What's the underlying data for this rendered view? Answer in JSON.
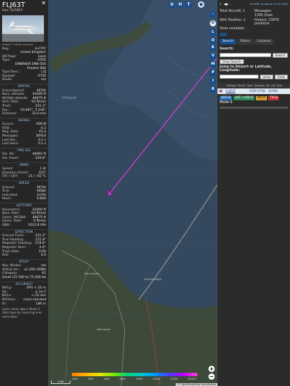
{
  "aircraft": {
    "callsign": "FLJ63T",
    "hex_line": "Hex: 407BF5",
    "photo_credit": "Image © Mario Santoro",
    "fields_top": [
      {
        "k": "Reg.:",
        "v": "G-FTFY"
      },
      {
        "k": "",
        "v": "United Kingdom"
      },
      {
        "k": "DB flags:",
        "v": "none"
      },
      {
        "k": "Type:",
        "v": "E550"
      },
      {
        "k": "",
        "v": "EMBRAER EMB-550"
      },
      {
        "k": "",
        "v": "Praetor 600"
      },
      {
        "k": "Type Desc.:",
        "v": "L2J"
      },
      {
        "k": "Squawk:",
        "v": "0756"
      },
      {
        "k": "Route:",
        "v": "n/a"
      }
    ],
    "spatial": [
      {
        "k": "Groundspeed:",
        "v": "467kt"
      },
      {
        "k": "Baro. altitude:",
        "v": "41000 ft"
      },
      {
        "k": "WGS84 altitude:",
        "v": "40675 ft"
      },
      {
        "k": "Vert. Rate:",
        "v": "64 ft/min"
      },
      {
        "k": "Track:",
        "v": "221.3°"
      },
      {
        "k": "Pos.:",
        "v": "53.067°, 5.030°"
      },
      {
        "k": "Distance:",
        "v": "33.0 nmi"
      }
    ],
    "signal": [
      {
        "k": "Source:",
        "v": "ADS-B"
      },
      {
        "k": "RSSI:",
        "v": "-4.2"
      },
      {
        "k": "Msg. Rate:",
        "v": "45.4"
      },
      {
        "k": "Messages:",
        "v": "30910"
      },
      {
        "k": "Last Pos.:",
        "v": "0.1 s"
      },
      {
        "k": "Last Seen:",
        "v": "0.1 s"
      }
    ],
    "fms": [
      {
        "k": "Sel. Alt.:",
        "v": "40992 ft"
      },
      {
        "k": "Sel. Head.:",
        "v": "220.8°"
      }
    ],
    "wind": [
      {
        "k": "Speed:",
        "v": "1 kt"
      },
      {
        "k": "Direction (from):",
        "v": "323°"
      },
      {
        "k": "TAT / OAT:",
        "v": "-21 / -50 °C"
      }
    ],
    "speed": [
      {
        "k": "Ground:",
        "v": "467kt"
      },
      {
        "k": "True:",
        "v": "468kt"
      },
      {
        "k": "Indicated:",
        "v": "237kt"
      },
      {
        "k": "Mach:",
        "v": "0.800"
      }
    ],
    "altitude": [
      {
        "k": "Barometric:",
        "v": "41000 ft"
      },
      {
        "k": "Baro. Rate:",
        "v": "64 ft/min"
      },
      {
        "k": "Geom. WGS84:",
        "v": "40675 ft"
      },
      {
        "k": "Geom. Rate:",
        "v": "0 ft/min"
      },
      {
        "k": "QNH:",
        "v": "1012.8 hPa"
      }
    ],
    "direction": [
      {
        "k": "Ground Track:",
        "v": "221.3°"
      },
      {
        "k": "True Heading:",
        "v": "221.9°"
      },
      {
        "k": "Magnetic Heading:",
        "v": "219.6°"
      },
      {
        "k": "Magnetic Decl.:",
        "v": "2.6°"
      },
      {
        "k": "Track Rate:",
        "v": "0.00"
      },
      {
        "k": "Roll:",
        "v": "0.0"
      }
    ],
    "stuff": [
      {
        "k": "Nav. Modes:",
        "v": "n/a"
      },
      {
        "k": "ADS-B Ver.:",
        "v": "v2 (DO-260B)"
      },
      {
        "k": "Category:",
        "v": "A2"
      },
      {
        "k": "",
        "v": "Small (15 500 to 75 000 lb)"
      }
    ],
    "accuracy": [
      {
        "k": "NACp:",
        "v": "EPU < 10 m"
      },
      {
        "k": "SIL:",
        "v": "≤ 1e-7"
      },
      {
        "k": "NACv:",
        "v": "< 10 m/s"
      },
      {
        "k": "NICbaro:",
        "v": "cross-checked"
      },
      {
        "k": "Rc:",
        "v": "186 m"
      }
    ],
    "sections": {
      "spatial": "SPATIAL",
      "signal": "SIGNAL",
      "fms": "FMS SEL",
      "wind": "WIND",
      "speed": "SPEED",
      "altitude": "ALTITUDE",
      "direction": "DIRECTION",
      "stuff": "STUFF",
      "accuracy": "ACCURACY"
    },
    "footer_note": "Learn more about Mode S data type by hovering over each label"
  },
  "map": {
    "top_buttons": [
      "U",
      "H",
      "T"
    ],
    "side_buttons": [
      "O",
      "L",
      "O",
      "K",
      "V",
      "M",
      "P",
      "I",
      "R"
    ],
    "zoom_in": "+",
    "zoom_out": "−",
    "attribution": "© OpenStreetMap contributors",
    "scale_label": "5 NM",
    "alt_ticks": [
      "2000",
      "4000",
      "6000",
      "8000",
      "10000",
      "20000",
      "30000",
      "40000+"
    ],
    "towns": [
      "Vlieland",
      "Den Helder",
      "Breezand",
      "Wieringen",
      "Breezanddijk"
    ],
    "colors": {
      "sea": "#34495e",
      "land": "#3d4a3a",
      "track": "#c642d6",
      "plane": "#d946e8"
    }
  },
  "right": {
    "version": "tar1090 on github (3.14.1703)",
    "stats": [
      {
        "k": "Total Aircraft:",
        "v": "1"
      },
      {
        "k": "Messages:",
        "v": "1390.2/sec"
      },
      {
        "k": "With Position:",
        "v": "1"
      },
      {
        "k": "History:",
        "v": "23878 positions"
      }
    ],
    "stats_available": "Stats available",
    "tabs": [
      "Search",
      "Filters",
      "Columns"
    ],
    "search_label": "Search:",
    "search_button": "Search",
    "clear_search": "Clear Search",
    "jump_label": "Jump to Airport or Latitude, Longitude:",
    "jump_button": "Jump",
    "clear_button": "Clear",
    "table_headers": [
      "Callsign",
      "Route",
      "Type",
      "Squawk",
      "Alt. (ft)",
      "Spd."
    ],
    "table_row": {
      "flag": "🇬🇧",
      "callsign": "FLJ63T",
      "route": "",
      "type": "E550",
      "squawk": "0756",
      "alt": "41000",
      "spd": ""
    },
    "sources": [
      "ADS-B",
      "UAT / ADS-R",
      "MLAT",
      "TIS-B"
    ],
    "modes_label": "Mode-S"
  }
}
